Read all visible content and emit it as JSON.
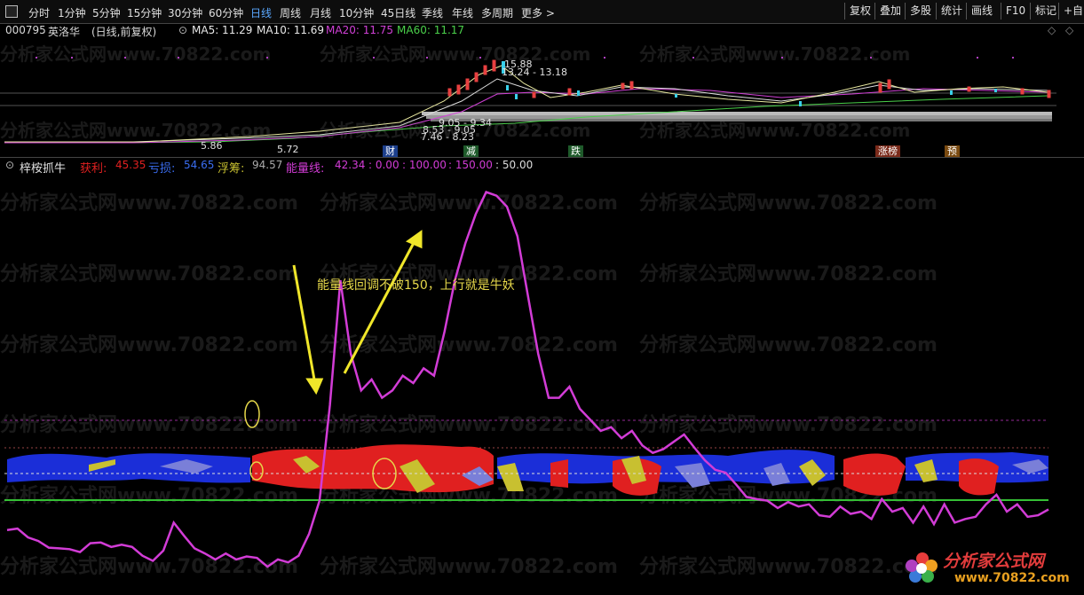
{
  "toolbar": {
    "tabs": [
      "分时",
      "1分钟",
      "5分钟",
      "15分钟",
      "30分钟",
      "60分钟",
      "日线",
      "周线",
      "月线",
      "10分钟",
      "45日线",
      "季线",
      "年线",
      "多周期",
      "更多 >"
    ],
    "buttons": [
      "复权",
      "叠加",
      "多股",
      "统计",
      "画线",
      "F10",
      "标记",
      "+自"
    ]
  },
  "stock": {
    "code": "000795",
    "name": "英洛华",
    "mode": "(日线,前复权)"
  },
  "ma": {
    "ma5": "MA5: 11.29",
    "ma10": "MA10: 11.69",
    "ma20": "MA20: 11.75",
    "ma60": "MA60: 11.17"
  },
  "price_labels": [
    "15.88",
    "13.24 - 13.18",
    "9.05 - 9.34",
    "8.53 - 9.05",
    "7.46 - 8.23",
    "5.86",
    "5.72"
  ],
  "event_flags": [
    {
      "label": "财",
      "color": "#2f6fd8"
    },
    {
      "label": "减",
      "color": "#3aa04a"
    },
    {
      "label": "跌",
      "color": "#3aa04a"
    },
    {
      "label": "涨榜",
      "color": "#c9543a"
    },
    {
      "label": "预",
      "color": "#d88a2a"
    }
  ],
  "indicator": {
    "name": "梓桉抓牛",
    "profit_label": "获利:",
    "profit_value": "45.35",
    "loss_label": "亏损:",
    "loss_value": "54.65",
    "float_label": "浮筹:",
    "float_value": "94.57",
    "energy_label": "能量线:",
    "energy_value": "42.34",
    "levels": [
      ": 0.00",
      ": 100.00",
      ": 150.00",
      ": 50.00"
    ]
  },
  "annotation": "能量线回调不破150，上行就是牛妖",
  "watermark": "分析家公式网www.70822.com",
  "logo": {
    "title": "分析家公式网",
    "url": "www.70822.com"
  },
  "colors": {
    "energy_line": "#d23cd6",
    "profit": "#e02020",
    "loss": "#1b2ed8",
    "float": "#c8c030",
    "baseline": "#35c035",
    "annotation": "#e6d84a"
  },
  "chart_data": {
    "type": "line",
    "series": [
      {
        "values": [
          -20,
          -18,
          -30,
          -35,
          -44,
          -45,
          -46,
          -50,
          -38,
          -37,
          -43,
          -40,
          -43,
          -55,
          -62,
          -48,
          -10,
          -28,
          -45,
          -52,
          -60,
          -52,
          -60,
          -56,
          -58,
          -70,
          -60,
          -64,
          -55,
          -25,
          20,
          150,
          320,
          220,
          170,
          185,
          160,
          170,
          190,
          180,
          200,
          190,
          250,
          320,
          370,
          410,
          440,
          435,
          420,
          380,
          300,
          220,
          160,
          160,
          175,
          145,
          130,
          115,
          120,
          105,
          115,
          95,
          85,
          90,
          100,
          110,
          92,
          75,
          62,
          58,
          42,
          25,
          22,
          20,
          10,
          18,
          12,
          15,
          0,
          -2,
          12,
          2,
          5,
          -5,
          22,
          5,
          10,
          -10,
          12,
          -12,
          15,
          -10,
          -5,
          -2,
          15,
          28,
          5,
          15,
          -2,
          0,
          8
        ]
      }
    ],
    "ylim": [
      -100,
      460
    ],
    "levels": [
      0,
      100,
      150,
      50
    ]
  }
}
